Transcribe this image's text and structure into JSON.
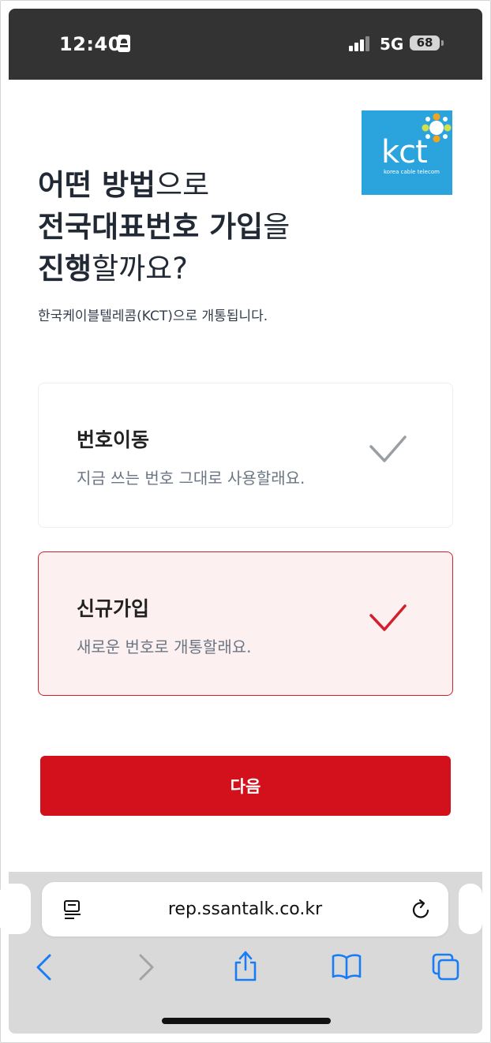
{
  "status_bar": {
    "time": "12:40",
    "network": "5G",
    "battery": "68"
  },
  "brand": {
    "logo_text": "kct",
    "logo_subtitle": "korea cable telecom",
    "logo_color": "#2ba4de"
  },
  "heading": {
    "line1_bold": "어떤 방법",
    "line1_rest": "으로",
    "line2_bold": "전국대표번호 가입",
    "line2_rest": "을",
    "line3_bold": "진행",
    "line3_rest": "할까요?"
  },
  "subtext": "한국케이블텔레콤(KCT)으로 개통됩니다.",
  "options": [
    {
      "title": "번호이동",
      "description": "지금 쓰는 번호 그대로 사용할래요.",
      "selected": false,
      "icon": "check-icon"
    },
    {
      "title": "신규가입",
      "description": "새로운 번호로 개통할래요.",
      "selected": true,
      "icon": "check-icon"
    }
  ],
  "next_button": {
    "label": "다음"
  },
  "browser": {
    "url": "rep.ssantalk.co.kr",
    "icons": [
      "page-menu-icon",
      "reload-icon",
      "back-icon",
      "forward-icon",
      "share-icon",
      "bookmarks-icon",
      "tabs-icon"
    ]
  },
  "colors": {
    "accent": "#d3111c",
    "selected_bg": "#fdf0f1",
    "status_bar_bg": "#333333",
    "toolbar_icon": "#1a7cf5"
  }
}
